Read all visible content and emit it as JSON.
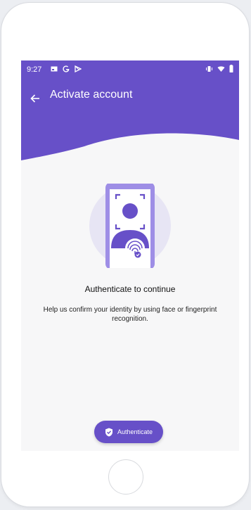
{
  "status_bar": {
    "time": "9:27"
  },
  "app_bar": {
    "title": "Activate account"
  },
  "content": {
    "headline": "Authenticate to continue",
    "description": "Help us confirm your identity by using face or fingerprint recognition."
  },
  "actions": {
    "authenticate_label": "Authenticate"
  },
  "icons": {
    "back": "arrow-left-icon",
    "shield": "shield-check-icon"
  },
  "colors": {
    "primary": "#6750c8",
    "primary_light": "#9e8ee6",
    "background": "#f7f7f8",
    "illustration_bg": "#e7e5f4"
  }
}
